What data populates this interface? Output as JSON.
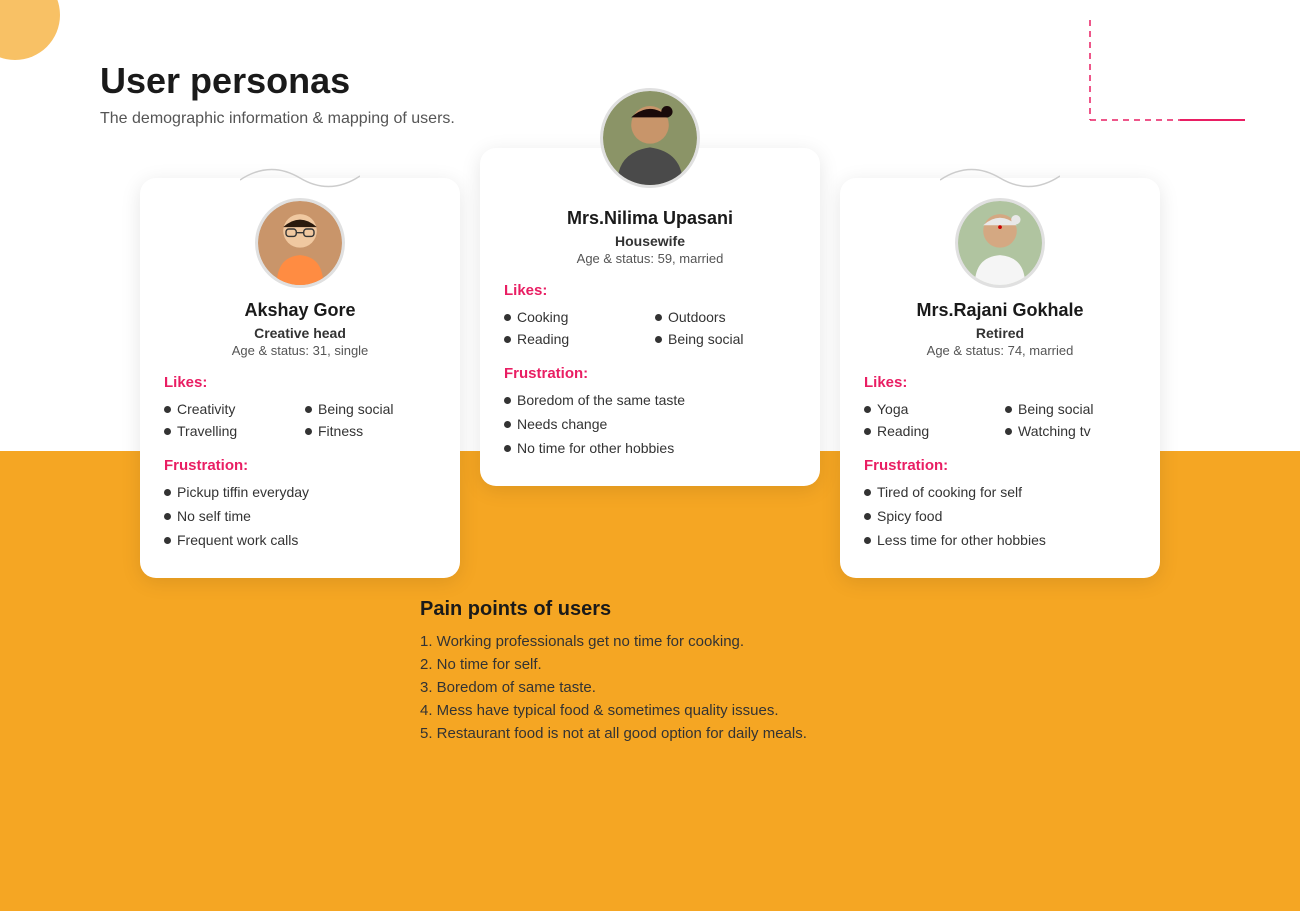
{
  "page": {
    "title": "User personas",
    "subtitle": "The demographic information & mapping of users."
  },
  "personas": [
    {
      "id": "akshay",
      "name": "Akshay Gore",
      "role": "Creative head",
      "age_status": "Age & status: 31, single",
      "likes_label": "Likes:",
      "likes": [
        "Creativity",
        "Being social",
        "Travelling",
        "Fitness"
      ],
      "frustration_label": "Frustration:",
      "frustrations": [
        "Pickup tiffin everyday",
        "No self time",
        "Frequent work calls"
      ]
    },
    {
      "id": "nilima",
      "name": "Mrs.Nilima Upasani",
      "role": "Housewife",
      "age_status": "Age & status: 59, married",
      "likes_label": "Likes:",
      "likes": [
        "Cooking",
        "Outdoors",
        "Reading",
        "Being social"
      ],
      "frustration_label": "Frustration:",
      "frustrations": [
        "Boredom of the same taste",
        "Needs change",
        "No time for other hobbies"
      ]
    },
    {
      "id": "rajani",
      "name": "Mrs.Rajani Gokhale",
      "role": "Retired",
      "age_status": "Age & status: 74, married",
      "likes_label": "Likes:",
      "likes": [
        "Yoga",
        "Being social",
        "Reading",
        "Watching tv"
      ],
      "frustration_label": "Frustration:",
      "frustrations": [
        "Tired of cooking for self",
        "Spicy food",
        "Less time for other hobbies"
      ]
    }
  ],
  "pain_points": {
    "title": "Pain points of users",
    "items": [
      "1. Working professionals get no time for cooking.",
      "2. No time for self.",
      "3. Boredom of same taste.",
      "4. Mess have typical food & sometimes quality issues.",
      "5. Restaurant food is not at all good option for daily meals."
    ]
  }
}
